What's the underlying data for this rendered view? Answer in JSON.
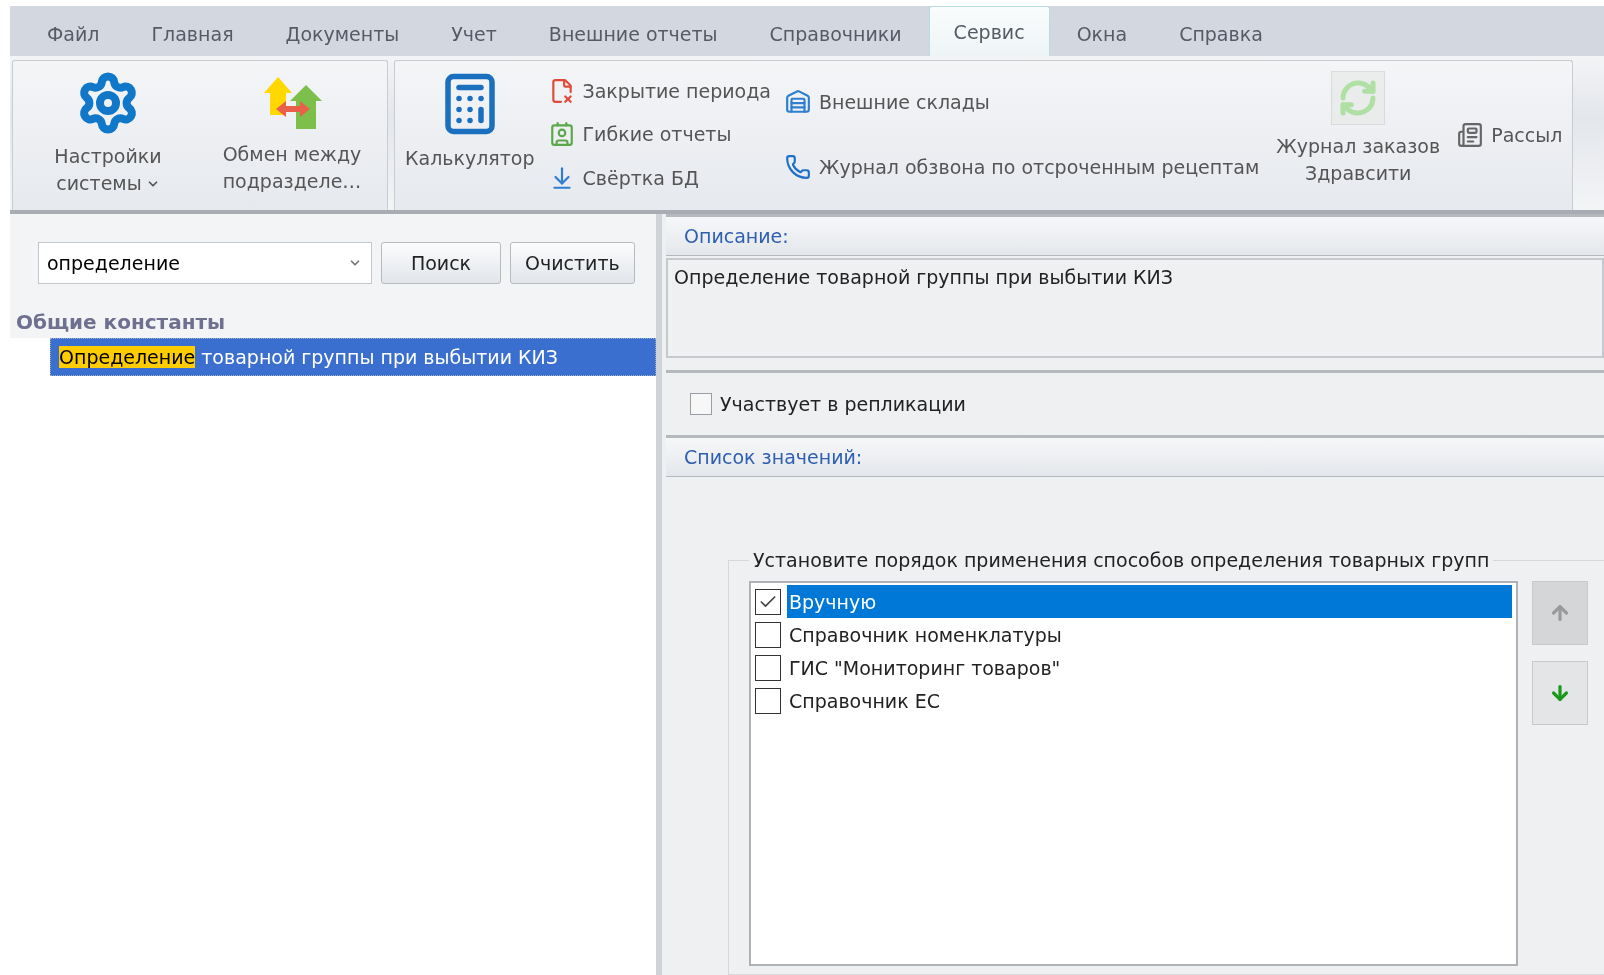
{
  "menu_tabs": [
    {
      "label": "Файл",
      "selected": false
    },
    {
      "label": "Главная",
      "selected": false
    },
    {
      "label": "Документы",
      "selected": false
    },
    {
      "label": "Учет",
      "selected": false
    },
    {
      "label": "Внешние отчеты",
      "selected": false
    },
    {
      "label": "Справочники",
      "selected": false
    },
    {
      "label": "Сервис",
      "selected": true
    },
    {
      "label": "Окна",
      "selected": false
    },
    {
      "label": "Справка",
      "selected": false
    }
  ],
  "ribbon": {
    "groups": [
      {
        "columns": [
          {
            "kind": "large",
            "label": "Настройки системы",
            "dropdown": true
          },
          {
            "kind": "large",
            "label": "Обмен между подразделе…",
            "dropdown": false
          }
        ]
      },
      {
        "columns": [
          {
            "kind": "large",
            "label": "Калькулятор",
            "dropdown": false
          },
          {
            "kind": "stack",
            "items": [
              "Закрытие периода",
              "Гибкие отчеты",
              "Свёртка БД"
            ]
          },
          {
            "kind": "stack",
            "items": [
              "Внешние склады",
              "Журнал обзвона по отсроченным рецептам"
            ]
          },
          {
            "kind": "large",
            "label": "Журнал заказов Здравсити",
            "dropdown": false,
            "disabled": true
          },
          {
            "kind": "stack",
            "items": [
              "Рассыл"
            ]
          }
        ]
      }
    ]
  },
  "search": {
    "value": "определение",
    "search_button": "Поиск",
    "clear_button": "Очистить"
  },
  "tree": {
    "group": "Общие константы",
    "items": [
      {
        "match": "Определение",
        "rest": " товарной группы при выбытии КИЗ",
        "selected": true
      }
    ]
  },
  "description": {
    "header": "Описание:",
    "text": "Определение товарной группы при выбытии КИЗ"
  },
  "replication": {
    "label": "Участвует в репликации",
    "checked": false
  },
  "values": {
    "header": "Список значений:",
    "legend": "Установите порядок применения способов определения товарных групп",
    "items": [
      {
        "label": "Вручную",
        "checked": true,
        "selected": true
      },
      {
        "label": "Справочник номенклатуры",
        "checked": false,
        "selected": false
      },
      {
        "label": "ГИС \"Мониторинг товаров\"",
        "checked": false,
        "selected": false
      },
      {
        "label": "Справочник ЕС",
        "checked": false,
        "selected": false
      }
    ],
    "move_up": {
      "disabled": true
    },
    "move_down": {
      "disabled": false
    }
  }
}
